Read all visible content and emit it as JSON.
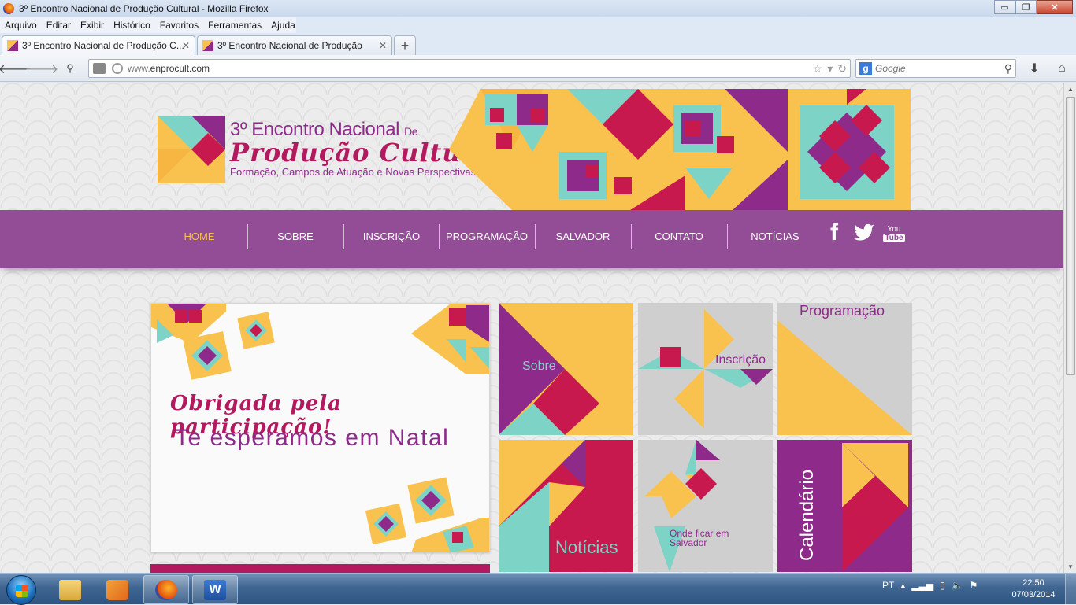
{
  "window": {
    "title": "3º Encontro Nacional de Produção Cultural - Mozilla Firefox",
    "buttons": {
      "minimize": "▭",
      "maximize": "❐",
      "close": "✕"
    }
  },
  "menu": [
    "Arquivo",
    "Editar",
    "Exibir",
    "Histórico",
    "Favoritos",
    "Ferramentas",
    "Ajuda"
  ],
  "tabs": [
    {
      "label": "3º Encontro Nacional de Produção C...",
      "active": true
    },
    {
      "label": "3º Encontro Nacional de Produção",
      "active": false
    }
  ],
  "toolbar": {
    "url_prefix": "www.",
    "url_domain": "enprocult.com",
    "search_engine": "g",
    "search_placeholder": "Google"
  },
  "site": {
    "logo_line1": "3º Encontro Nacional",
    "logo_line1_suffix": "De",
    "logo_line2": "Produção Cultural",
    "logo_line3": "Formação, Campos de Atuação e Novas Perspectivas",
    "nav": [
      "HOME",
      "SOBRE",
      "INSCRIÇÃO",
      "PROGRAMAÇÃO",
      "SALVADOR",
      "CONTATO",
      "NOTÍCIAS"
    ],
    "social": {
      "facebook": "f",
      "youtube_top": "You",
      "youtube_bottom": "Tube"
    },
    "slide_line1": "Obrigada pela participação!",
    "slide_line2": "Te esperamos em Natal",
    "tiles": {
      "sobre": "Sobre",
      "inscricao": "Inscrição",
      "programacao": "Programação",
      "noticias": "Notícias",
      "onde_ficar_1": "Onde ficar em",
      "onde_ficar_2": "Salvador",
      "calendario": "Calendário"
    }
  },
  "colors": {
    "purple": "#8e2a8a",
    "nav_purple": "#934d96",
    "magenta": "#c8194f",
    "yellow": "#f9c24f",
    "teal": "#7dd3c6",
    "grey": "#cfcfcf"
  },
  "taskbar": {
    "apps": [
      "explorer-icon",
      "media-player-icon",
      "firefox-icon",
      "word-icon"
    ],
    "language": "PT",
    "time": "22:50",
    "date": "07/03/2014"
  }
}
